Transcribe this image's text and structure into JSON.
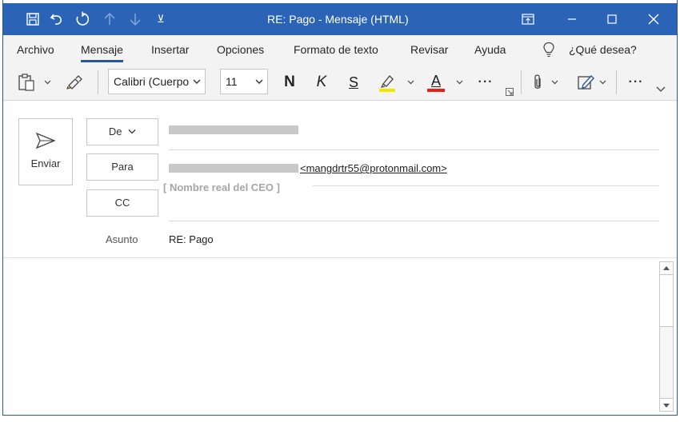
{
  "titlebar": {
    "title": "RE: Pago  -  Mensaje (HTML)",
    "customize_symbol": "⊻"
  },
  "tabs": [
    {
      "label": "Archivo"
    },
    {
      "label": "Mensaje"
    },
    {
      "label": "Insertar"
    },
    {
      "label": "Opciones"
    },
    {
      "label": "Formato de texto"
    },
    {
      "label": "Revisar"
    },
    {
      "label": "Ayuda"
    }
  ],
  "tellme": {
    "label": "¿Qué desea?"
  },
  "ribbon": {
    "font_name": "Calibri (Cuerpo",
    "font_size": "11",
    "bold": "N",
    "italic": "K",
    "underline": "S",
    "font_color_letter": "A",
    "more_dots": "···",
    "more_dots2": "···",
    "highlight_color": "#f2e600",
    "font_color": "#e2231a"
  },
  "compose": {
    "send_label": "Enviar",
    "from_label": "De",
    "to_label": "Para",
    "cc_label": "CC",
    "subject_label": "Asunto",
    "to_address": "<mangdrtr55@protonmail.com>",
    "ceo_annotation": "[ Nombre real del CEO ]",
    "subject_value": "RE: Pago"
  }
}
